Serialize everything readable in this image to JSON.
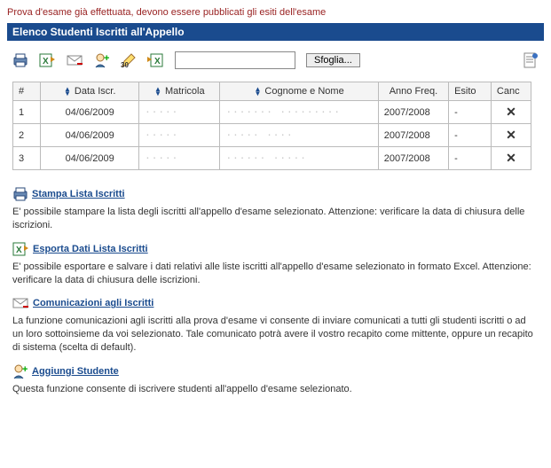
{
  "notice": "Prova d'esame già effettuata, devono essere pubblicati gli esiti dell'esame",
  "section_title": "Elenco Studenti Iscritti all'Appello",
  "toolbar": {
    "browse_label": "Sfoglia...",
    "file_value": ""
  },
  "table": {
    "headers": {
      "num": "#",
      "data_iscr": "Data Iscr.",
      "matricola": "Matricola",
      "cognome_nome": "Cognome e Nome",
      "anno_freq": "Anno Freq.",
      "esito": "Esito",
      "canc": "Canc"
    },
    "rows": [
      {
        "n": "1",
        "data": "04/06/2009",
        "matricola": "·····",
        "nome": "······· ·········",
        "anno": "2007/2008",
        "esito": "-"
      },
      {
        "n": "2",
        "data": "04/06/2009",
        "matricola": "·····",
        "nome": "····· ····",
        "anno": "2007/2008",
        "esito": "-"
      },
      {
        "n": "3",
        "data": "04/06/2009",
        "matricola": "·····",
        "nome": "······ ·····",
        "anno": "2007/2008",
        "esito": "-"
      }
    ]
  },
  "help": {
    "stampa": {
      "title": "Stampa Lista Iscritti",
      "body": "E' possibile stampare la lista degli iscritti all'appello d'esame selezionato. Attenzione: verificare la data di chiusura delle iscrizioni."
    },
    "esporta": {
      "title": "Esporta Dati Lista Iscritti",
      "body": "E' possibile esportare e salvare i dati relativi alle liste iscritti all'appello d'esame selezionato in formato Excel. Attenzione: verificare la data di chiusura delle iscrizioni."
    },
    "comunicazioni": {
      "title": "Comunicazioni agli Iscritti",
      "body": "La funzione comunicazioni agli iscritti alla prova d'esame vi consente di inviare comunicati a tutti gli studenti iscritti o ad un loro sottoinsieme da voi selezionato. Tale comunicato potrà avere il vostro recapito come mittente, oppure un recapito di sistema (scelta di default)."
    },
    "aggiungi": {
      "title": "Aggiungi Studente",
      "body": "Questa funzione consente di iscrivere studenti all'appello d'esame selezionato."
    }
  }
}
